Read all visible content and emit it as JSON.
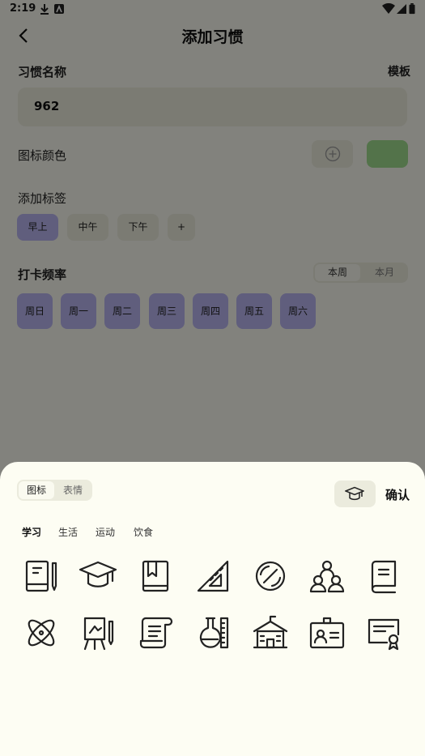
{
  "status": {
    "time": "2:19"
  },
  "header": {
    "title": "添加习惯"
  },
  "habit_name": {
    "label": "习惯名称",
    "template_link": "模板",
    "value": "962"
  },
  "icon_color": {
    "label": "图标颜色",
    "selected_color": "#9fdc8f"
  },
  "tags": {
    "label": "添加标签",
    "items": [
      "早上",
      "中午",
      "下午",
      "+"
    ],
    "selected_index": 0
  },
  "frequency": {
    "label": "打卡频率",
    "tabs": [
      "本周",
      "本月"
    ],
    "selected_tab": 0,
    "days": [
      "周日",
      "周一",
      "周二",
      "周三",
      "周四",
      "周五",
      "周六"
    ]
  },
  "sheet": {
    "tabs": [
      "图标",
      "表情"
    ],
    "selected_tab": 0,
    "confirm_label": "确认",
    "categories": [
      "学习",
      "生活",
      "运动",
      "饮食"
    ],
    "selected_category": 0,
    "preview_icon": "graduation-cap-icon",
    "icons": [
      "book-pencil-icon",
      "graduation-cap-icon",
      "bookmark-book-icon",
      "ruler-triangle-icon",
      "compass-circle-icon",
      "students-group-icon",
      "textbook-icon",
      "atom-icon",
      "easel-icon",
      "scroll-icon",
      "flask-ruler-icon",
      "school-building-icon",
      "id-card-icon",
      "certificate-icon"
    ]
  },
  "colors": {
    "accent": "#b8b5f0",
    "page_bg": "#fafaf0",
    "chip_bg": "#ebebdd",
    "green": "#9fdc8f"
  }
}
